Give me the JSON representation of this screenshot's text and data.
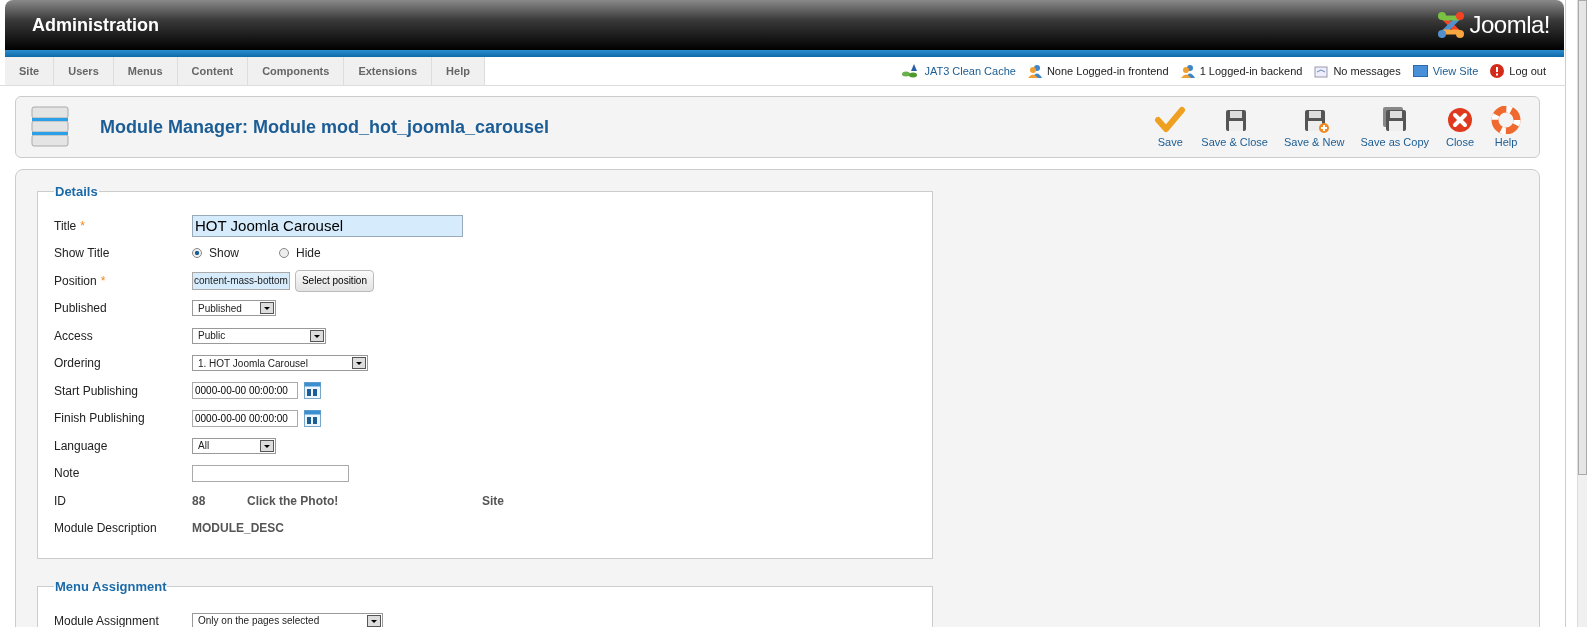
{
  "header": {
    "title": "Administration",
    "logo": "Joomla!"
  },
  "menu": [
    "Site",
    "Users",
    "Menus",
    "Content",
    "Components",
    "Extensions",
    "Help"
  ],
  "status": [
    {
      "label": "JAT3 Clean Cache",
      "kind": "link"
    },
    {
      "label": "None Logged-in frontend",
      "kind": "text"
    },
    {
      "label": "1 Logged-in backend",
      "kind": "text"
    },
    {
      "label": "No messages",
      "kind": "text"
    },
    {
      "label": "View Site",
      "kind": "link"
    },
    {
      "label": "Log out",
      "kind": "text"
    }
  ],
  "toolbar": {
    "title": "Module Manager: Module mod_hot_joomla_carousel",
    "buttons": [
      "Save",
      "Save & Close",
      "Save & New",
      "Save as Copy",
      "Close",
      "Help"
    ]
  },
  "details": {
    "legend": "Details",
    "fields": [
      {
        "kind": "text",
        "label": "Title",
        "required_mark": "*",
        "value": "HOT Joomla Carousel"
      },
      {
        "kind": "radio",
        "label": "Show Title",
        "options": [
          {
            "label": "Show",
            "selected": true
          },
          {
            "label": "Hide",
            "selected": false
          }
        ]
      },
      {
        "kind": "position",
        "label": "Position",
        "required_mark": "*",
        "value": "content-mass-bottom",
        "button": "Select position"
      },
      {
        "kind": "select",
        "label": "Published",
        "value": "Published"
      },
      {
        "kind": "select",
        "label": "Access",
        "value": "Public"
      },
      {
        "kind": "select",
        "label": "Ordering",
        "value": "1. HOT Joomla Carousel"
      },
      {
        "kind": "date",
        "label": "Start Publishing",
        "value": "0000-00-00 00:00:00"
      },
      {
        "kind": "date",
        "label": "Finish Publishing",
        "value": "0000-00-00 00:00:00"
      },
      {
        "kind": "select",
        "label": "Language",
        "value": "All"
      },
      {
        "kind": "input",
        "label": "Note"
      },
      {
        "kind": "info",
        "label": "ID",
        "values": [
          "88",
          "Click the Photo!",
          "Site"
        ]
      },
      {
        "kind": "info",
        "label": "Module Description",
        "values": [
          "MODULE_DESC"
        ]
      }
    ]
  },
  "menu_assignment": {
    "legend": "Menu Assignment",
    "fields": [
      {
        "kind": "select",
        "label": "Module Assignment",
        "value": "Only on the pages selected"
      }
    ]
  }
}
